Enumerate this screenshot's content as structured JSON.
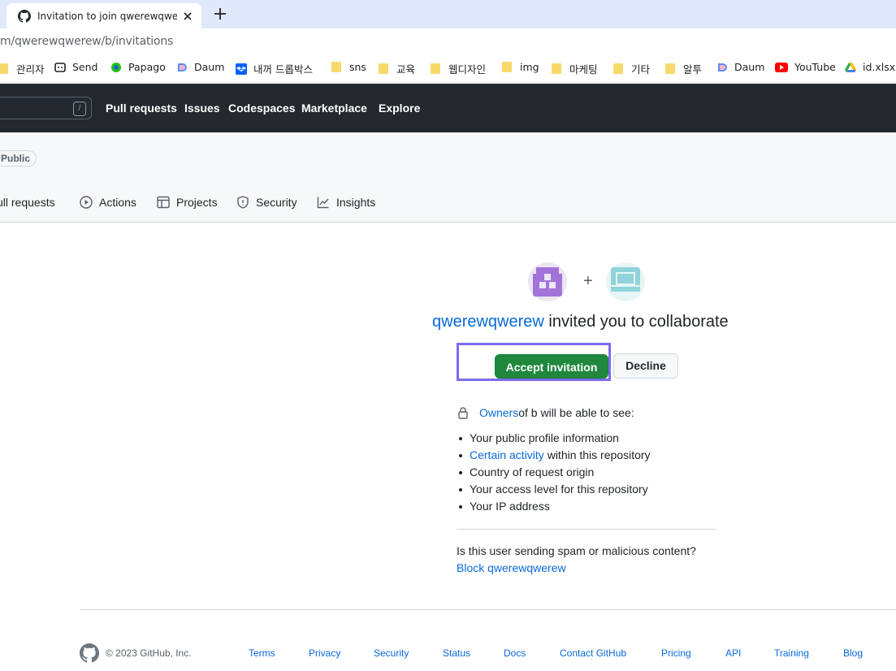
{
  "browser": {
    "tab": {
      "title": "Invitation to join qwerewqwerew/b"
    },
    "url": "m/qwerewqwerew/b/invitations",
    "bookmarks": [
      {
        "label": "관리자",
        "icon": "folder-icon"
      },
      {
        "label": "Send",
        "icon": "send-icon"
      },
      {
        "label": "Papago",
        "icon": "papago-icon"
      },
      {
        "label": "Daum",
        "icon": "daum-icon"
      },
      {
        "label": "내꺼 드롭박스",
        "icon": "dropbox-icon"
      },
      {
        "label": "sns",
        "icon": "folder-icon"
      },
      {
        "label": "교육",
        "icon": "folder-icon"
      },
      {
        "label": "웹디자인",
        "icon": "folder-icon"
      },
      {
        "label": "img",
        "icon": "folder-icon"
      },
      {
        "label": "마케팅",
        "icon": "folder-icon"
      },
      {
        "label": "기타",
        "icon": "folder-icon"
      },
      {
        "label": "알투",
        "icon": "folder-icon"
      },
      {
        "label": "Daum",
        "icon": "daum-icon"
      },
      {
        "label": "YouTube",
        "icon": "youtube-icon"
      },
      {
        "label": "id.xlsx -",
        "icon": "drive-icon"
      }
    ]
  },
  "header": {
    "search_shortcut": "/",
    "nav": [
      "Pull requests",
      "Issues",
      "Codespaces",
      "Marketplace",
      "Explore"
    ]
  },
  "repo": {
    "visibility": "Public",
    "tabs": [
      {
        "label": "ull requests",
        "icon": "pull-request-icon"
      },
      {
        "label": "Actions",
        "icon": "play-icon"
      },
      {
        "label": "Projects",
        "icon": "table-icon"
      },
      {
        "label": "Security",
        "icon": "shield-icon"
      },
      {
        "label": "Insights",
        "icon": "graph-icon"
      }
    ]
  },
  "invite": {
    "plus": "+",
    "inviter": "qwerewqwerew",
    "message": " invited you to collaborate",
    "accept_label": "Accept invitation",
    "decline_label": "Decline",
    "owners_link": "Owners",
    "owners_text": " of b will be able to see:",
    "permissions": [
      {
        "link": "",
        "text": "Your public profile information"
      },
      {
        "link": "Certain activity",
        "text": " within this repository"
      },
      {
        "link": "",
        "text": "Country of request origin"
      },
      {
        "link": "",
        "text": "Your access level for this repository"
      },
      {
        "link": "",
        "text": "Your IP address"
      }
    ],
    "spam_question": "Is this user sending spam or malicious content?",
    "block_link": "Block qwerewqwerew"
  },
  "footer": {
    "copyright": "© 2023 GitHub, Inc.",
    "links": [
      "Terms",
      "Privacy",
      "Security",
      "Status",
      "Docs",
      "Contact GitHub",
      "Pricing",
      "API",
      "Training",
      "Blog"
    ]
  },
  "colors": {
    "accent_link": "#0969da",
    "accept_green": "#1f883d",
    "focus_outline": "#7b6cf0",
    "header_dark": "#24292f"
  }
}
